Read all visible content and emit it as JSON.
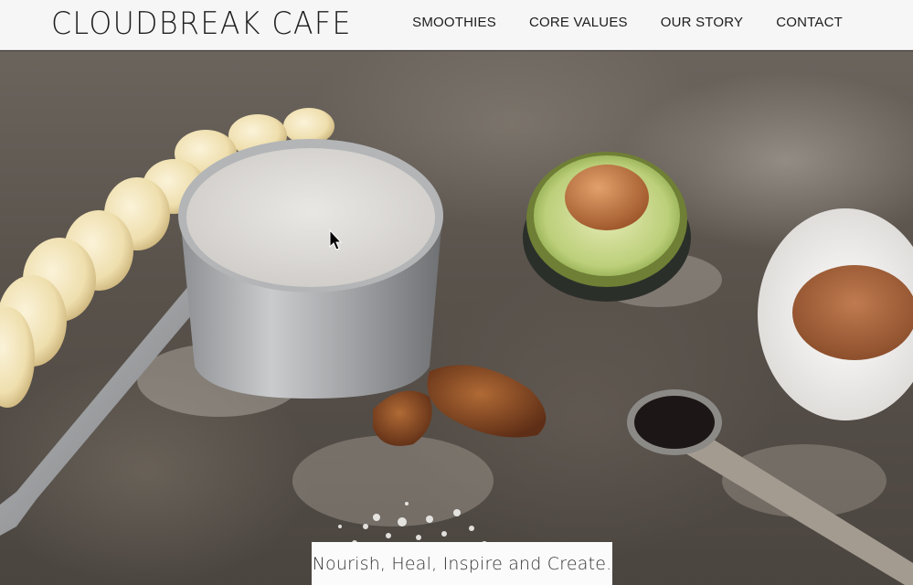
{
  "brand": {
    "logo_text": "CLOUDBREAK CAFE"
  },
  "nav": {
    "items": [
      {
        "label": "SMOOTHIES"
      },
      {
        "label": "CORE VALUES"
      },
      {
        "label": "OUR STORY"
      },
      {
        "label": "CONTACT"
      }
    ]
  },
  "hero": {
    "tagline": "Nourish, Heal, Inspire and Create.",
    "image_elements": [
      "banana-slices",
      "milk-saucepan",
      "avocado-half",
      "cocoa-bowl",
      "dates",
      "vanilla-measuring-spoon",
      "sea-salt"
    ]
  },
  "colors": {
    "header_bg": "#f6f6f6",
    "nav_text": "#1c1c1c",
    "tagline_bg": "#fbfbfb"
  }
}
